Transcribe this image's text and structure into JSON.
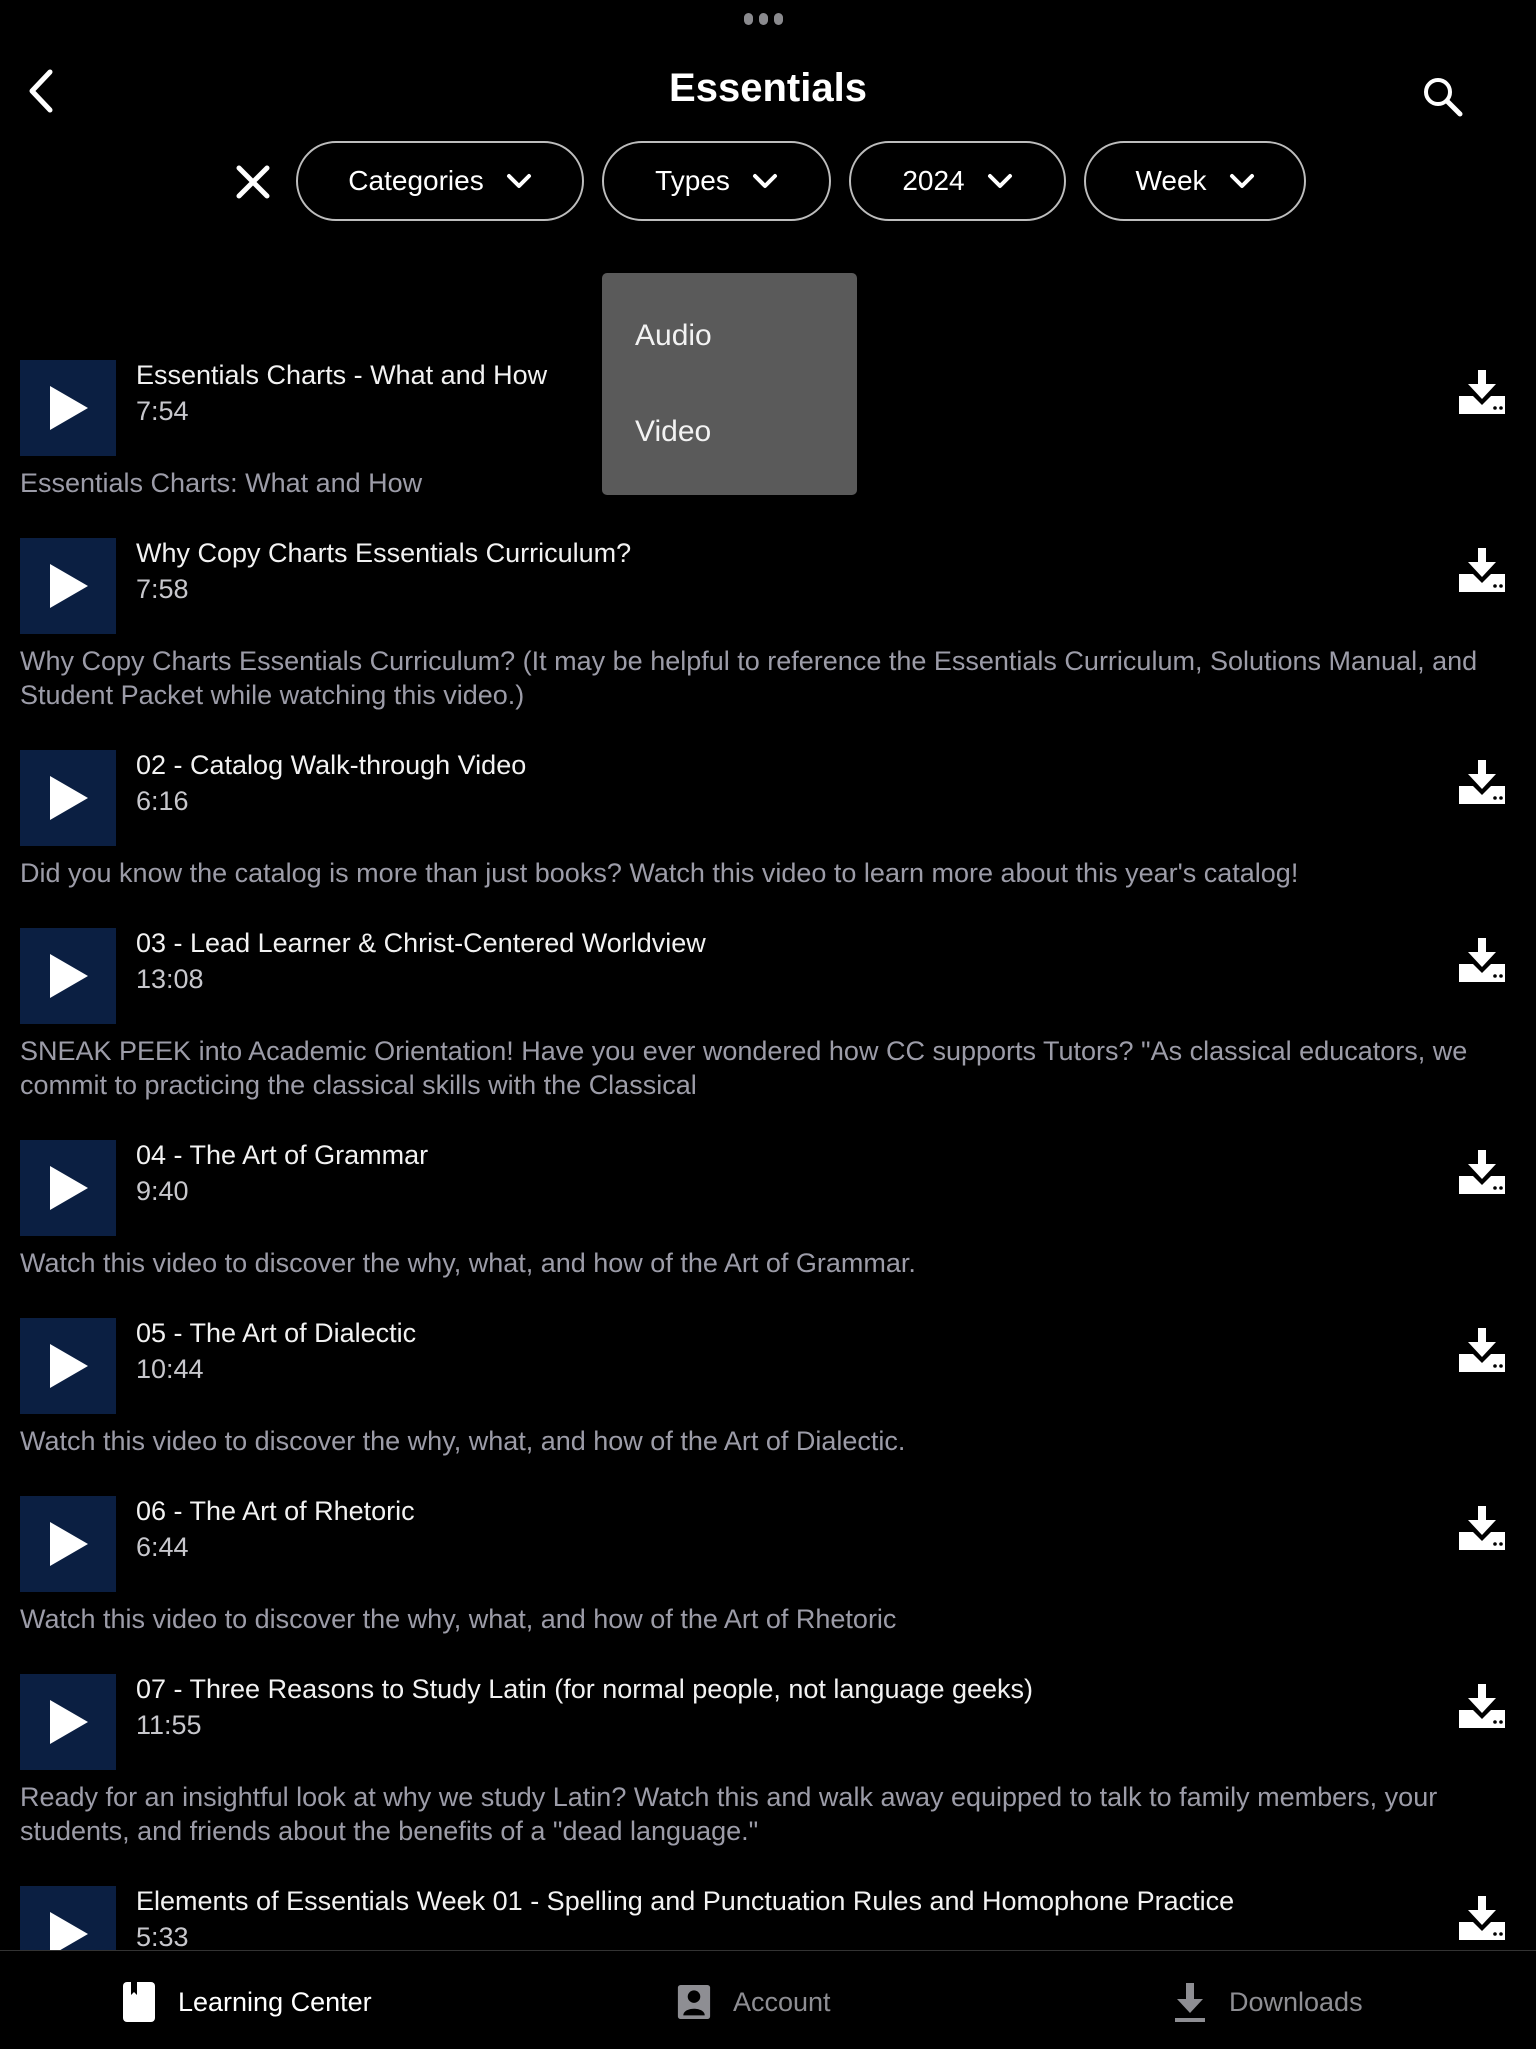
{
  "header": {
    "title": "Essentials",
    "back_icon": "chevron-left-icon",
    "search_icon": "search-icon",
    "more_icon": "ellipsis-icon"
  },
  "filters": {
    "clear_icon": "close-icon",
    "pills": [
      {
        "label": "Categories"
      },
      {
        "label": "Types"
      },
      {
        "label": "2024"
      },
      {
        "label": "Week"
      }
    ]
  },
  "types_dropdown": {
    "options": [
      "Audio",
      "Video"
    ]
  },
  "items": [
    {
      "title": "Essentials Charts - What and How",
      "duration": "7:54",
      "description": "Essentials Charts:  What and How"
    },
    {
      "title": "Why Copy Charts Essentials Curriculum?",
      "duration": "7:58",
      "description": "Why Copy Charts Essentials Curriculum? (It may be helpful to reference the Essentials Curriculum,  Solutions Manual, and Student Packet while watching this video.)"
    },
    {
      "title": "02 - Catalog Walk-through Video",
      "duration": "6:16",
      "description": "Did you know the catalog is more than just books? Watch this video to learn more about this year's catalog!"
    },
    {
      "title": "03 - Lead Learner & Christ-Centered Worldview",
      "duration": "13:08",
      "description": "SNEAK PEEK into Academic Orientation! Have you ever wondered how CC supports Tutors?  \"As classical educators, we commit to practicing the classical skills with the Classical"
    },
    {
      "title": "04 - The Art of Grammar",
      "duration": "9:40",
      "description": "Watch this video to discover the why, what, and how of the Art of Grammar."
    },
    {
      "title": "05 - The Art of Dialectic",
      "duration": "10:44",
      "description": "Watch this video to discover the why, what, and how of the Art of Dialectic."
    },
    {
      "title": "06 - The Art of Rhetoric",
      "duration": "6:44",
      "description": "Watch this video to discover the why, what, and how of the Art of Rhetoric"
    },
    {
      "title": "07 - Three Reasons to Study Latin (for normal people, not language geeks)",
      "duration": "11:55",
      "description": "Ready for an insightful look at why we study Latin? Watch this and walk away equipped to talk to family members, your students, and friends about the benefits of a \"dead language.\""
    },
    {
      "title": "Elements of Essentials Week 01 - Spelling and Punctuation Rules and Homophone Practice",
      "duration": "5:33",
      "description": ""
    }
  ],
  "tabbar": {
    "tabs": [
      {
        "label": "Learning Center",
        "active": true
      },
      {
        "label": "Account",
        "active": false
      },
      {
        "label": "Downloads",
        "active": false
      }
    ]
  },
  "colors": {
    "background": "#000000",
    "thumbnail": "#0b1f42",
    "dropdown": "#5a5a5a",
    "muted_text": "#9c9ca8",
    "inactive_tab": "#8e8e93"
  }
}
